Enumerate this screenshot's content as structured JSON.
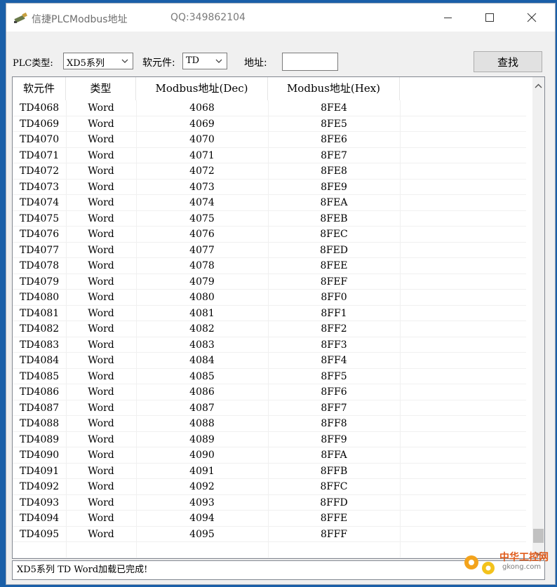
{
  "window": {
    "title": "信捷PLCModbus地址",
    "qq": "QQ:349862104"
  },
  "toolbar": {
    "plc_type_label": "PLC类型:",
    "plc_type_value": "XD5系列",
    "element_label": "软元件:",
    "element_value": "TD",
    "address_label": "地址:",
    "address_value": "",
    "find_label": "查找"
  },
  "table": {
    "columns": [
      "软元件",
      "类型",
      "Modbus地址(Dec)",
      "Modbus地址(Hex)"
    ],
    "rows": [
      [
        "TD4068",
        "Word",
        "4068",
        "8FE4"
      ],
      [
        "TD4069",
        "Word",
        "4069",
        "8FE5"
      ],
      [
        "TD4070",
        "Word",
        "4070",
        "8FE6"
      ],
      [
        "TD4071",
        "Word",
        "4071",
        "8FE7"
      ],
      [
        "TD4072",
        "Word",
        "4072",
        "8FE8"
      ],
      [
        "TD4073",
        "Word",
        "4073",
        "8FE9"
      ],
      [
        "TD4074",
        "Word",
        "4074",
        "8FEA"
      ],
      [
        "TD4075",
        "Word",
        "4075",
        "8FEB"
      ],
      [
        "TD4076",
        "Word",
        "4076",
        "8FEC"
      ],
      [
        "TD4077",
        "Word",
        "4077",
        "8FED"
      ],
      [
        "TD4078",
        "Word",
        "4078",
        "8FEE"
      ],
      [
        "TD4079",
        "Word",
        "4079",
        "8FEF"
      ],
      [
        "TD4080",
        "Word",
        "4080",
        "8FF0"
      ],
      [
        "TD4081",
        "Word",
        "4081",
        "8FF1"
      ],
      [
        "TD4082",
        "Word",
        "4082",
        "8FF2"
      ],
      [
        "TD4083",
        "Word",
        "4083",
        "8FF3"
      ],
      [
        "TD4084",
        "Word",
        "4084",
        "8FF4"
      ],
      [
        "TD4085",
        "Word",
        "4085",
        "8FF5"
      ],
      [
        "TD4086",
        "Word",
        "4086",
        "8FF6"
      ],
      [
        "TD4087",
        "Word",
        "4087",
        "8FF7"
      ],
      [
        "TD4088",
        "Word",
        "4088",
        "8FF8"
      ],
      [
        "TD4089",
        "Word",
        "4089",
        "8FF9"
      ],
      [
        "TD4090",
        "Word",
        "4090",
        "8FFA"
      ],
      [
        "TD4091",
        "Word",
        "4091",
        "8FFB"
      ],
      [
        "TD4092",
        "Word",
        "4092",
        "8FFC"
      ],
      [
        "TD4093",
        "Word",
        "4093",
        "8FFD"
      ],
      [
        "TD4094",
        "Word",
        "4094",
        "8FFE"
      ],
      [
        "TD4095",
        "Word",
        "4095",
        "8FFF"
      ]
    ]
  },
  "status": {
    "text": "XD5系列 TD Word加载已完成!"
  },
  "watermark": {
    "name": "中华工控网",
    "site": "gkong.com"
  },
  "colors": {
    "desktop": "#1a5fa8",
    "window_bg": "#f0f0f0",
    "title_text": "#6e6e6e"
  }
}
